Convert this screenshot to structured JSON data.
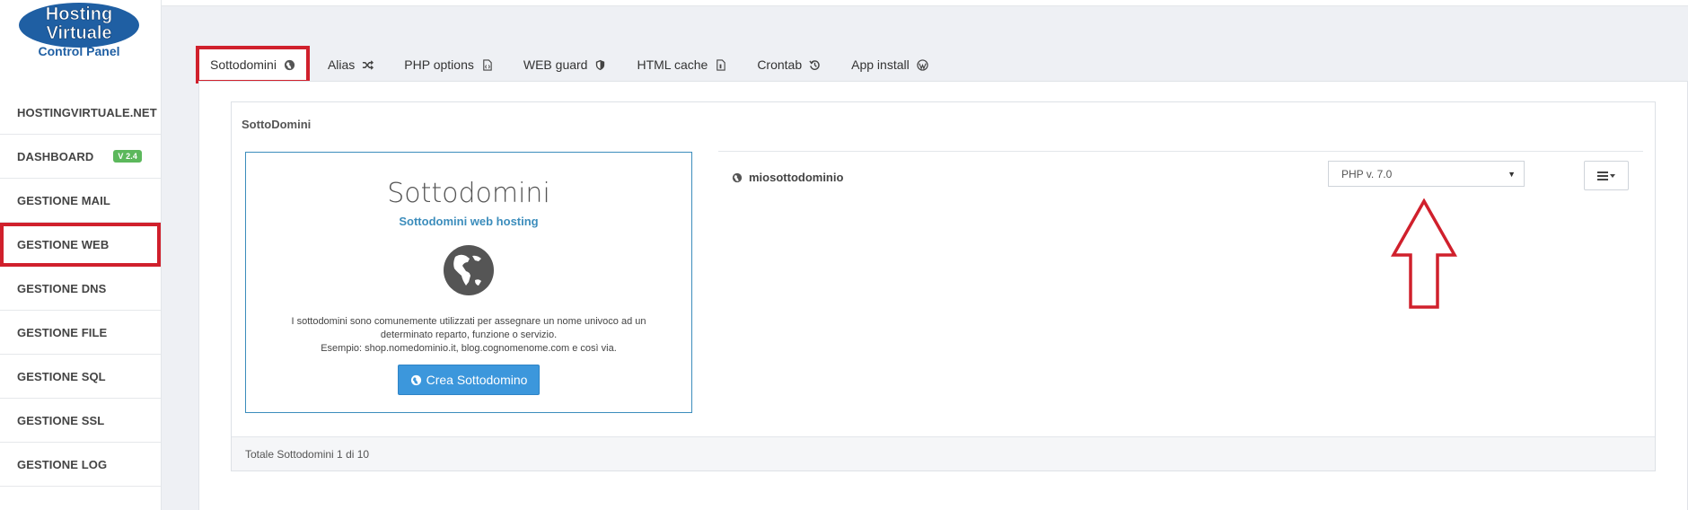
{
  "brand": {
    "logo_line1": "Hosting",
    "logo_line2": "Virtuale",
    "logo_line3": "Control Panel",
    "accent": "#3c8dbc",
    "highlight": "#d0202c"
  },
  "sidebar": {
    "items": [
      {
        "label": "HOSTINGVIRTUALE.NET"
      },
      {
        "label": "DASHBOARD",
        "badge": "V 2.4"
      },
      {
        "label": "GESTIONE MAIL"
      },
      {
        "label": "GESTIONE WEB"
      },
      {
        "label": "GESTIONE DNS"
      },
      {
        "label": "GESTIONE FILE"
      },
      {
        "label": "GESTIONE SQL"
      },
      {
        "label": "GESTIONE SSL"
      },
      {
        "label": "GESTIONE LOG"
      }
    ]
  },
  "tabs": [
    {
      "label": "Sottodomini",
      "icon": "globe-icon"
    },
    {
      "label": "Alias",
      "icon": "shuffle-icon"
    },
    {
      "label": "PHP options",
      "icon": "file-code-icon"
    },
    {
      "label": "WEB guard",
      "icon": "shield-icon"
    },
    {
      "label": "HTML cache",
      "icon": "file-icon"
    },
    {
      "label": "Crontab",
      "icon": "history-icon"
    },
    {
      "label": "App install",
      "icon": "wordpress-icon"
    }
  ],
  "panel": {
    "title": "SottoDomini",
    "footer": "Totale Sottodomini 1 di 10"
  },
  "info": {
    "title": "Sottodomini",
    "subtitle": "Sottodomini web hosting",
    "text_line1": "I sottodomini sono comunemente utilizzati per assegnare un nome univoco ad un",
    "text_line2": "determinato reparto, funzione o servizio.",
    "text_line3": "Esempio: shop.nomedominio.it, blog.cognomenome.com e così via.",
    "button_label": "Crea Sottodomino"
  },
  "subdomain": {
    "name": "miosottodominio",
    "php_version": "PHP v. 7.0"
  }
}
